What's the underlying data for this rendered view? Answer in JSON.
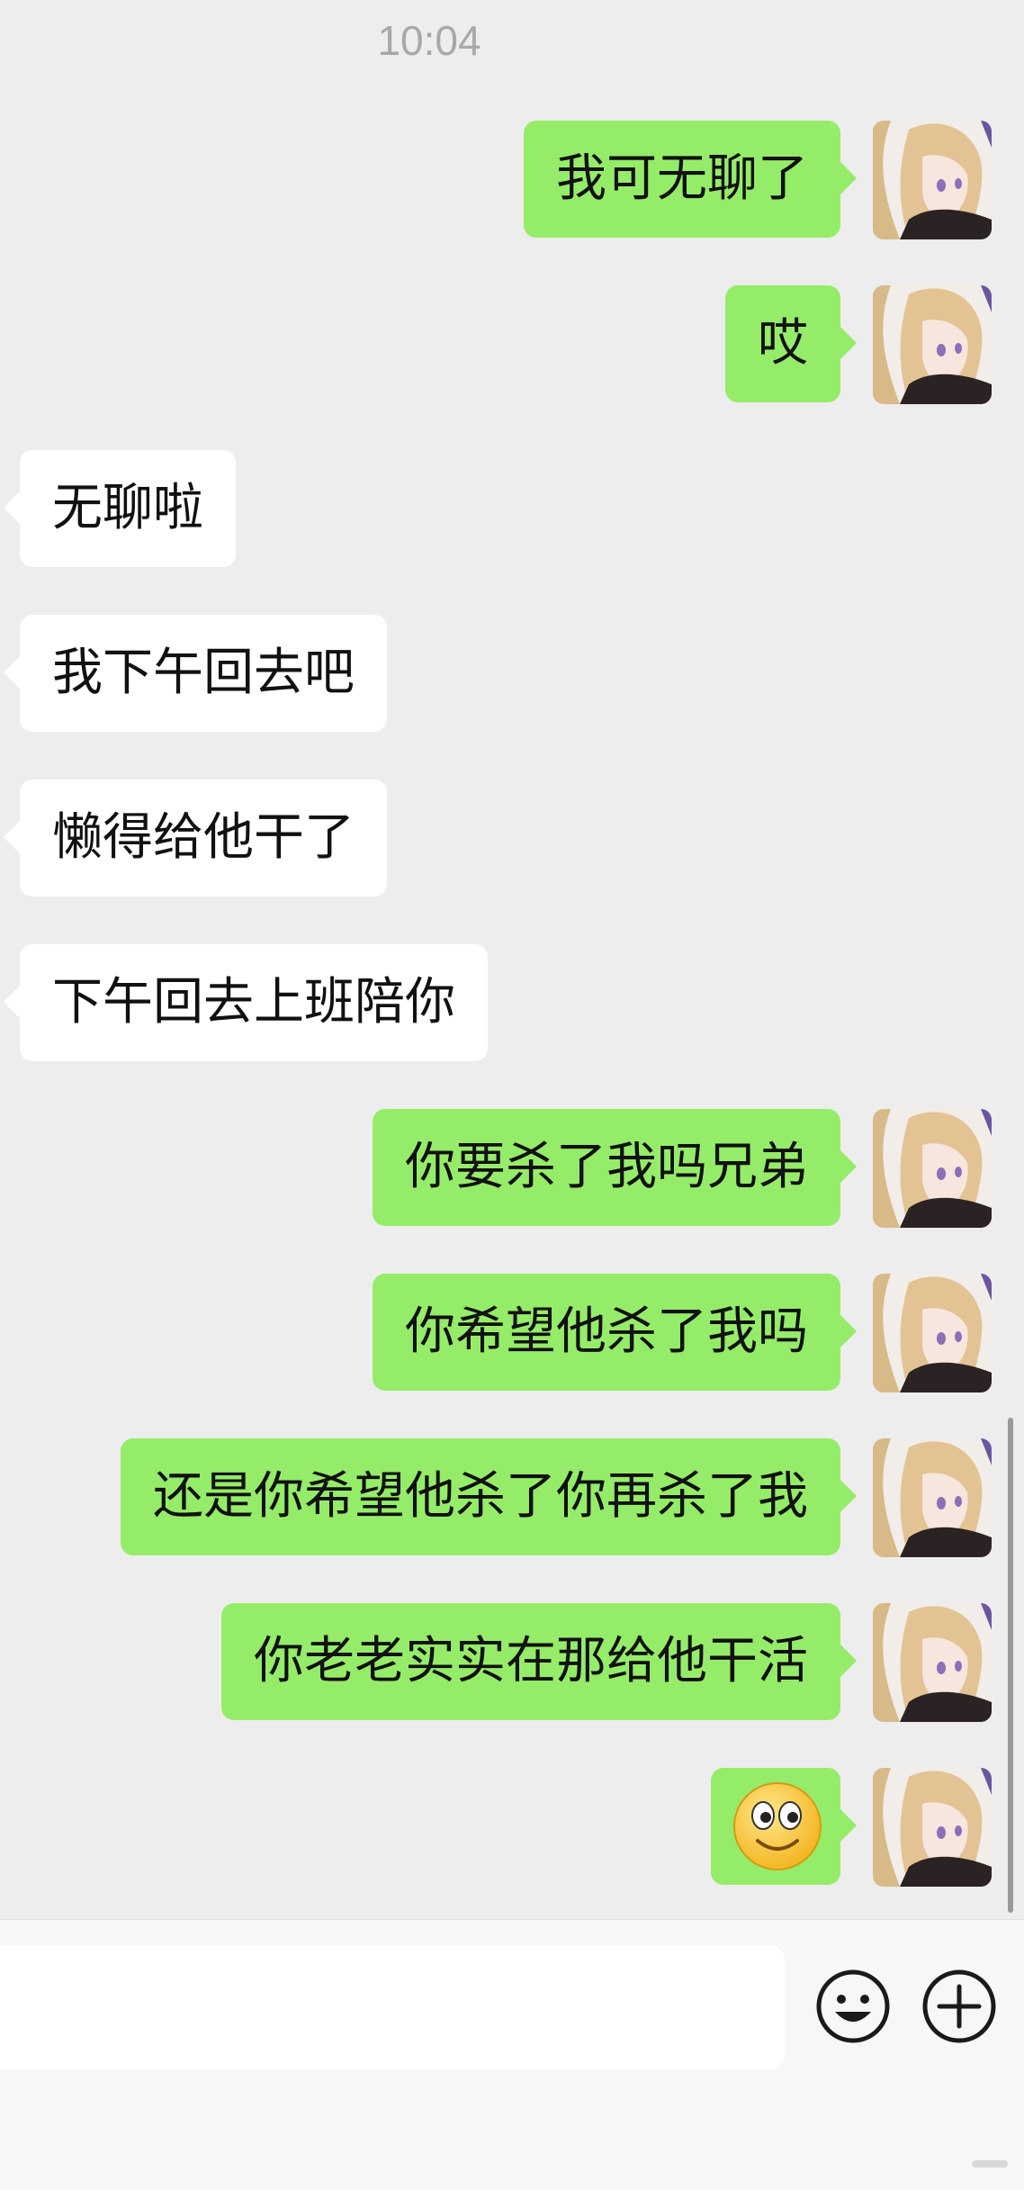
{
  "timestamp": "10:04",
  "messages": [
    {
      "side": "right",
      "text": "我可无聊了"
    },
    {
      "side": "right",
      "text": "哎"
    },
    {
      "side": "left",
      "text": "无聊啦"
    },
    {
      "side": "left",
      "text": "我下午回去吧"
    },
    {
      "side": "left",
      "text": "懒得给他干了"
    },
    {
      "side": "left",
      "text": "下午回去上班陪你"
    },
    {
      "side": "right",
      "text": "你要杀了我吗兄弟"
    },
    {
      "side": "right",
      "text": "你希望他杀了我吗"
    },
    {
      "side": "right",
      "text": "还是你希望他杀了你再杀了我"
    },
    {
      "side": "right",
      "text": "你老老实实在那给他干活"
    },
    {
      "side": "right",
      "text": "",
      "emoji": "smiley-emoji"
    }
  ],
  "input_bar": {
    "placeholder": "",
    "emoji_button_icon": "smiley-face-icon",
    "more_button_icon": "plus-circle-icon"
  },
  "colors": {
    "background": "#ededed",
    "sent_bubble": "#95ec69",
    "received_bubble": "#ffffff",
    "timestamp": "#a8a8a8"
  }
}
